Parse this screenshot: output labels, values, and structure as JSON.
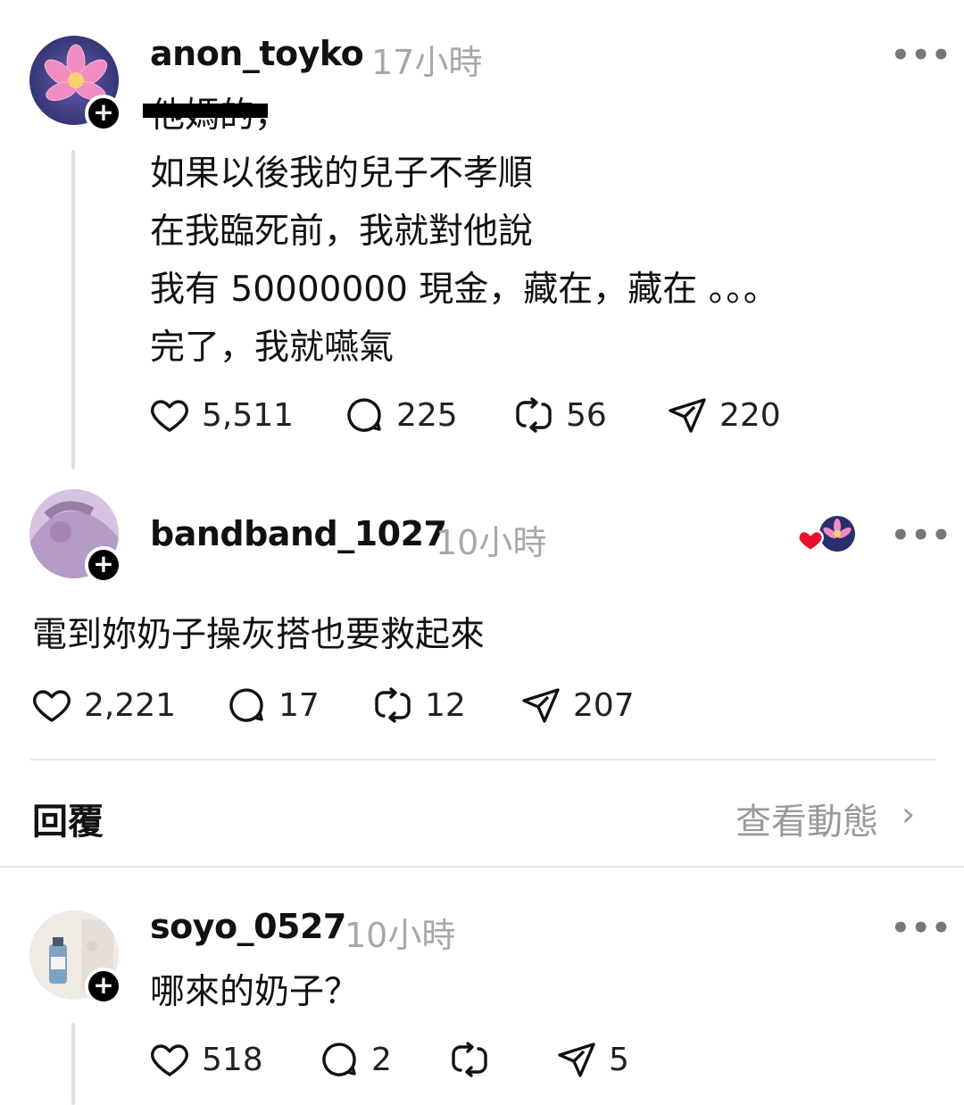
{
  "posts": [
    {
      "username": "anon_toyko",
      "time": "17小時",
      "more": "•••",
      "lines": [
        "他媽的，",
        "如果以後我的兒子不孝順",
        "在我臨死前，我就對他說",
        "我有 50000000 現金，藏在，藏在 。。。",
        "完了，我就�NAN氣"
      ],
      "likes": "5,511",
      "comments": "225",
      "reposts": "56",
      "shares": "220"
    },
    {
      "username": "bandband_1027",
      "time": "10小時",
      "more": "•••",
      "lines": [
        "電到妳奶子操灰搭也要救起來"
      ],
      "likes": "2,221",
      "comments": "17",
      "reposts": "12",
      "shares": "207"
    },
    {
      "username": "soyo_0527",
      "time": "10小時",
      "more": "•••",
      "lines": [
        "哪來的奶子？"
      ],
      "likes": "518",
      "comments": "2",
      "reposts": "",
      "shares": "5"
    }
  ],
  "reply_bar": {
    "reply_label": "回覆",
    "view_activity": "查看動態",
    "chevron": "›"
  },
  "colors": {
    "muted": "#a8a8a8",
    "divider": "#e6e6e6",
    "like_heart": "#e8102c"
  }
}
